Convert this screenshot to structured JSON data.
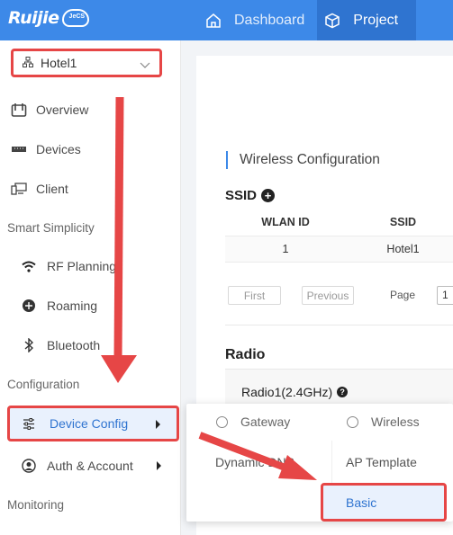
{
  "header": {
    "brand": "Ruijie",
    "brand_badge": "JeCS",
    "tabs": [
      {
        "label": "Dashboard",
        "icon": "home-icon",
        "active": false
      },
      {
        "label": "Project",
        "icon": "cube-icon",
        "active": true
      }
    ],
    "accent_color": "#3d89e8"
  },
  "sidebar": {
    "site_selector": {
      "value": "Hotel1",
      "icon": "network-tree-icon"
    },
    "items": [
      {
        "label": "Overview",
        "icon": "overview-icon"
      },
      {
        "label": "Devices",
        "icon": "switch-icon"
      },
      {
        "label": "Client",
        "icon": "client-icon"
      }
    ],
    "sections": [
      {
        "label": "Smart Simplicity",
        "items": [
          {
            "label": "RF Planning",
            "icon": "wifi-icon"
          },
          {
            "label": "Roaming",
            "icon": "roaming-icon"
          },
          {
            "label": "Bluetooth",
            "icon": "bluetooth-icon"
          }
        ]
      },
      {
        "label": "Configuration",
        "items": [
          {
            "label": "Device Config",
            "icon": "sliders-icon",
            "active": true
          },
          {
            "label": "Auth & Account",
            "icon": "user-circle-icon"
          }
        ]
      },
      {
        "label": "Monitoring",
        "items": []
      }
    ]
  },
  "main": {
    "section_title": "Wireless Configuration",
    "ssid": {
      "title": "SSID",
      "columns": [
        "WLAN ID",
        "SSID"
      ],
      "rows": [
        [
          "1",
          "Hotel1"
        ]
      ],
      "pagination": {
        "first": "First",
        "previous": "Previous",
        "page_label": "Page",
        "page_value": "1"
      }
    },
    "radio": {
      "title": "Radio",
      "radio1_label": "Radio1(2.4GHz)"
    }
  },
  "submenu": {
    "gateway": "Gateway",
    "wireless": "Wireless",
    "dynamic": "Dynamic DNS",
    "ap_template": "AP Template",
    "basic": "Basic"
  },
  "annotation_color": "#e64646"
}
